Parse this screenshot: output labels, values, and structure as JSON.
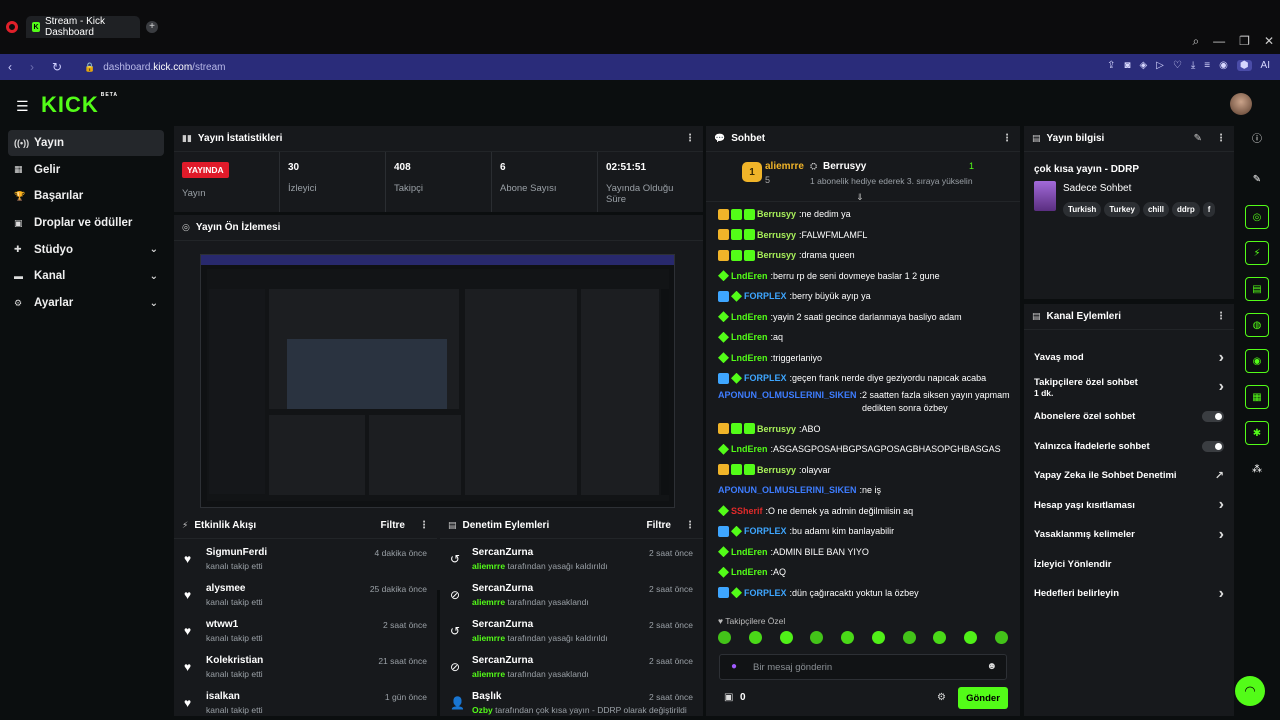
{
  "browser": {
    "tab_title": "Stream - Kick Dashboard",
    "url_prefix": "dashboard.",
    "url_domain": "kick.com",
    "url_path": "/stream",
    "ai_label": "AI"
  },
  "logo": {
    "text": "KICK",
    "beta": "BETA"
  },
  "sidebar": {
    "items": [
      {
        "label": "Yayın",
        "icon": "broadcast-icon",
        "glyph": "((•))"
      },
      {
        "label": "Gelir",
        "icon": "revenue-icon",
        "glyph": "▦"
      },
      {
        "label": "Başarılar",
        "icon": "trophy-icon",
        "glyph": "🏆"
      },
      {
        "label": "Droplar ve ödüller",
        "icon": "gift-icon",
        "glyph": "▣"
      },
      {
        "label": "Stüdyo",
        "icon": "studio-icon",
        "glyph": "✚"
      },
      {
        "label": "Kanal",
        "icon": "channel-icon",
        "glyph": "▬"
      },
      {
        "label": "Ayarlar",
        "icon": "settings-icon",
        "glyph": "⚙"
      }
    ]
  },
  "stats": {
    "title": "Yayın İstatistikleri",
    "live": "YAYINDA",
    "live_label": "Yayın",
    "viewers": "30",
    "viewers_label": "İzleyici",
    "followers": "408",
    "followers_label": "Takipçi",
    "subs": "6",
    "subs_label": "Abone Sayısı",
    "uptime": "02:51:51",
    "uptime_label": "Yayında Olduğu Süre"
  },
  "preview": {
    "title": "Yayın Ön İzlemesi"
  },
  "activity": {
    "title": "Etkinlik Akışı",
    "filter": "Filtre",
    "rows": [
      {
        "name": "SigmunFerdi",
        "sub": "kanalı takip etti",
        "time": "4 dakika önce"
      },
      {
        "name": "alysmee",
        "sub": "kanalı takip etti",
        "time": "25 dakika önce"
      },
      {
        "name": "wtww1",
        "sub": "kanalı takip etti",
        "time": "2 saat önce"
      },
      {
        "name": "Kolekristian",
        "sub": "kanalı takip etti",
        "time": "21 saat önce"
      },
      {
        "name": "isalkan",
        "sub": "kanalı takip etti",
        "time": "1 gün önce"
      }
    ]
  },
  "moderation": {
    "title": "Denetim Eylemleri",
    "filter": "Filtre",
    "rows": [
      {
        "name": "SercanZurna",
        "by": "aliemrre",
        "sub": " tarafından yasağı kaldırıldı",
        "time": "2 saat önce"
      },
      {
        "name": "SercanZurna",
        "by": "aliemrre",
        "sub": " tarafından yasaklandı",
        "time": "2 saat önce"
      },
      {
        "name": "SercanZurna",
        "by": "aliemrre",
        "sub": " tarafından yasağı kaldırıldı",
        "time": "2 saat önce"
      },
      {
        "name": "SercanZurna",
        "by": "aliemrre",
        "sub": " tarafından yasaklandı",
        "time": "2 saat önce"
      },
      {
        "name": "Başlık",
        "by": "Ozby",
        "sub": " tarafından çok kısa yayın - DDRP olarak değiştirildi",
        "time": "2 saat önce"
      }
    ]
  },
  "chat": {
    "title": "Sohbet",
    "pinned_user": "aliemrre",
    "pinned_count": "5",
    "pinned_rank": "1",
    "gifter": "Berrusyy",
    "gift_count": "1",
    "gift_text": "1 abonelik hediye ederek 3. sıraya yükselin",
    "messages": [
      {
        "user": "Berrusyy",
        "color": "#a8f05a",
        "text": "ne dedim ya",
        "badges": 3
      },
      {
        "user": "Berrusyy",
        "color": "#a8f05a",
        "text": "FALWFMLAMFL",
        "badges": 3
      },
      {
        "user": "Berrusyy",
        "color": "#a8f05a",
        "text": "drama queen",
        "badges": 3
      },
      {
        "user": "LndEren",
        "color": "#53fc18",
        "text": "berru rp de seni dovmeye baslar 1 2 gune",
        "badges": 1
      },
      {
        "user": "FORPLEX",
        "color": "#3ea6ff",
        "text": "berry büyük ayıp ya",
        "badges": 2
      },
      {
        "user": "LndEren",
        "color": "#53fc18",
        "text": "yayin 2 saati gecince darlanmaya basliyo adam",
        "badges": 1
      },
      {
        "user": "LndEren",
        "color": "#53fc18",
        "text": "aq",
        "badges": 1
      },
      {
        "user": "LndEren",
        "color": "#53fc18",
        "text": "triggerlaniyo",
        "badges": 1
      },
      {
        "user": "FORPLEX",
        "color": "#3ea6ff",
        "text": "geçen frank nerde diye geziyordu napıcak acaba",
        "badges": 2
      },
      {
        "user": "APONUN_OLMUSLERINI_SIKEN",
        "color": "#3e7dff",
        "text": "2 saatten fazla siksen yayın yapmam dedikten sonra özbey",
        "badges": 0,
        "wrap": true
      },
      {
        "user": "Berrusyy",
        "color": "#a8f05a",
        "text": "ABO",
        "badges": 3
      },
      {
        "user": "LndEren",
        "color": "#53fc18",
        "text": "ASGASGPOSAHBGPSAGPOSAGBHASOPGHBASGAS",
        "badges": 1
      },
      {
        "user": "Berrusyy",
        "color": "#a8f05a",
        "text": "olayvar",
        "badges": 3
      },
      {
        "user": "APONUN_OLMUSLERINI_SIKEN",
        "color": "#3e7dff",
        "text": "ne iş",
        "badges": 0
      },
      {
        "user": "SSherif",
        "color": "#e02a2a",
        "text": "O ne demek ya admin değilmiisin aq",
        "badges": 1
      },
      {
        "user": "FORPLEX",
        "color": "#3ea6ff",
        "text": "bu adamı kim banlayabilir",
        "badges": 2
      },
      {
        "user": "LndEren",
        "color": "#53fc18",
        "text": "ADMIN BILE BAN YIYO",
        "badges": 1
      },
      {
        "user": "LndEren",
        "color": "#53fc18",
        "text": "AQ",
        "badges": 1
      },
      {
        "user": "FORPLEX",
        "color": "#3ea6ff",
        "text": "dün çağıracaktı yoktun la özbey",
        "badges": 2
      }
    ],
    "followers_only_label": "Takipçilere Özel",
    "input_placeholder": "Bir mesaj gönderin",
    "points": "0",
    "send": "Gönder"
  },
  "stream_info": {
    "title": "Yayın bilgisi",
    "stream_title": "çok kısa yayın - DDRP",
    "category": "Sadece Sohbet",
    "tags": [
      "Turkish",
      "Turkey",
      "chill",
      "ddrp",
      "f"
    ]
  },
  "channel_actions": {
    "title": "Kanal Eylemleri",
    "items": [
      {
        "label": "Yavaş mod",
        "type": "chevron"
      },
      {
        "label": "Takipçilere özel sohbet",
        "sub": "1 dk.",
        "type": "chevron"
      },
      {
        "label": "Abonelere özel sohbet",
        "type": "toggle"
      },
      {
        "label": "Yalnızca İfadelerle sohbet",
        "type": "toggle"
      },
      {
        "label": "Yapay Zeka ile Sohbet Denetimi",
        "type": "external"
      },
      {
        "label": "Hesap yaşı kısıtlaması",
        "type": "chevron"
      },
      {
        "label": "Yasaklanmış kelimeler",
        "type": "chevron"
      },
      {
        "label": "İzleyici Yönlendir",
        "type": "none"
      },
      {
        "label": "Hedefleri belirleyin",
        "type": "chevron"
      }
    ]
  },
  "colors": {
    "accent": "#53fc18",
    "panel": "#17191c",
    "bg": "#0b0e0f",
    "live": "#e01b2a"
  }
}
